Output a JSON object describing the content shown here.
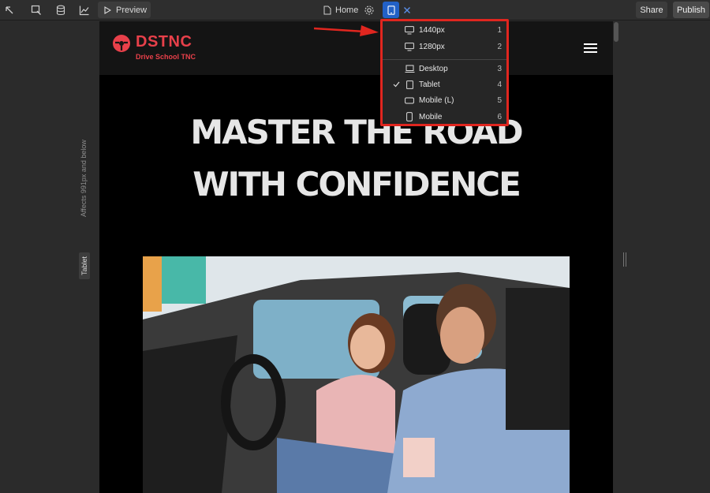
{
  "toolbar": {
    "preview_label": "Preview",
    "page_label": "Home",
    "share_label": "Share",
    "publish_label": "Publish"
  },
  "side_panel": {
    "affects_text": "Affects 991px and below",
    "breakpoint_label": "Tablet"
  },
  "breakpoints_menu": {
    "items": [
      {
        "label": "1440px",
        "shortcut": "1",
        "icon": "monitor-icon",
        "checked": false
      },
      {
        "label": "1280px",
        "shortcut": "2",
        "icon": "monitor-icon",
        "checked": false
      },
      {
        "label": "Desktop",
        "shortcut": "3",
        "icon": "laptop-icon",
        "checked": false
      },
      {
        "label": "Tablet",
        "shortcut": "4",
        "icon": "tablet-icon",
        "checked": true
      },
      {
        "label": "Mobile (L)",
        "shortcut": "5",
        "icon": "mobile-landscape-icon",
        "checked": false
      },
      {
        "label": "Mobile",
        "shortcut": "6",
        "icon": "mobile-icon",
        "checked": false
      }
    ]
  },
  "site": {
    "logo_name": "DSTNC",
    "logo_sub": "Drive School TNC",
    "hero_line1": "MASTER THE ROAD",
    "hero_line2": "WITH CONFIDENCE"
  },
  "colors": {
    "accent_blue": "#2261c7",
    "brand_red": "#e8404a",
    "highlight_red": "#e0261f"
  }
}
